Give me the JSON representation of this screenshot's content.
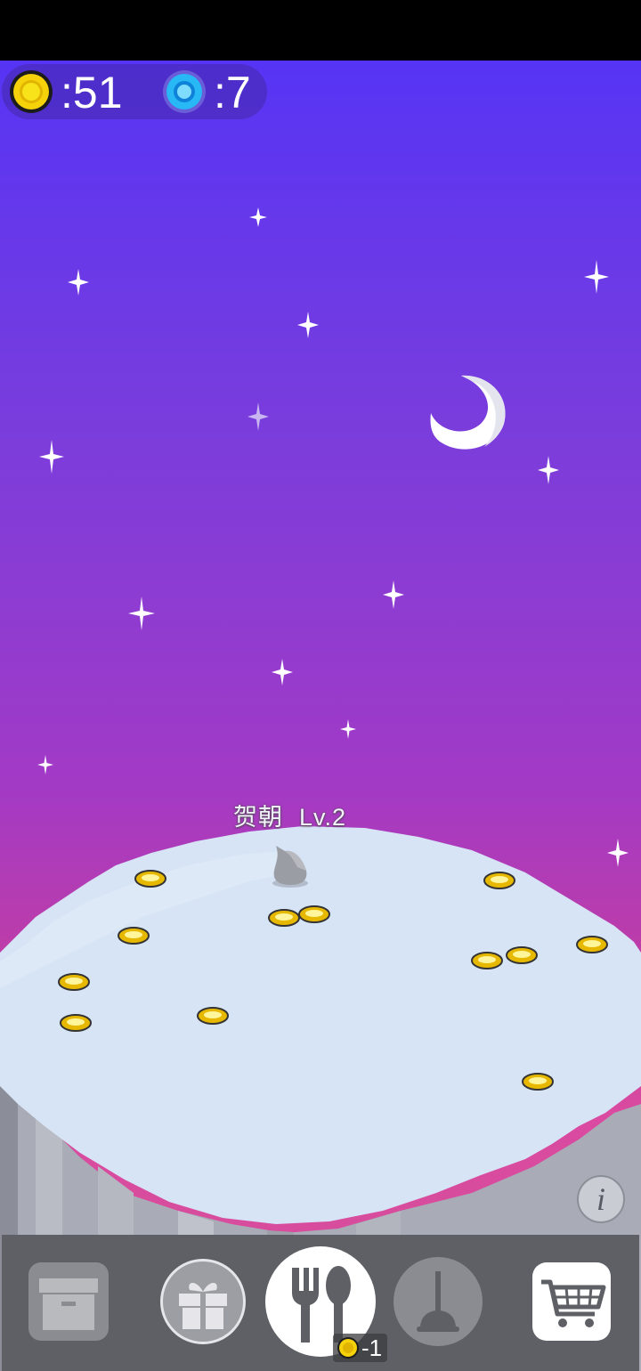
{
  "hud": {
    "coin_text": ":51",
    "gem_text": ":7"
  },
  "pet": {
    "name": "贺朝",
    "level": "Lv.2"
  },
  "toolbar": {
    "food_cost": "-1",
    "buttons": [
      "storage-box-icon",
      "gift-icon",
      "fork-spoon-icon",
      "plunger-icon",
      "shopping-cart-icon"
    ]
  },
  "colors": {
    "coin": "#f5d20a",
    "gem": "#27b8f5",
    "sky_top": "#5634f5",
    "sky_bottom": "#d64f9b",
    "ground": "#d6e4f6"
  }
}
